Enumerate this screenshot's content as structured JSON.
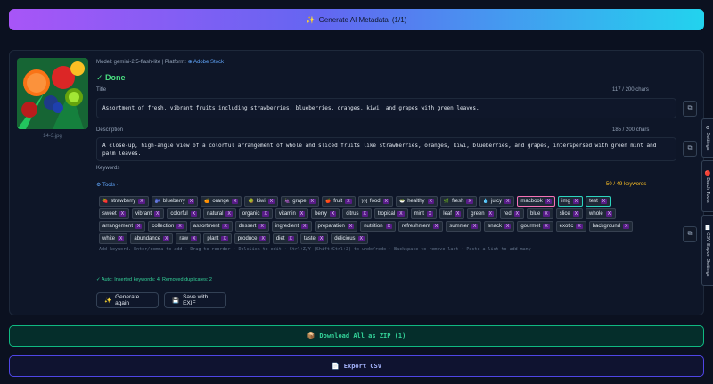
{
  "generate_button": {
    "icon": "✨",
    "label": "Generate AI Metadata",
    "count": "(1/1)"
  },
  "image": {
    "filename": "14-3.jpg"
  },
  "meta": {
    "model_label": "Model: gemini-2.5-flash-lite | Platform:",
    "platform_icon": "⊕",
    "platform": "Adobe Stock"
  },
  "status": "✓ Done",
  "title": {
    "label": "Title",
    "count": "117 / 200 chars",
    "value": "Assortment of fresh, vibrant fruits including strawberries, blueberries, oranges, kiwi, and grapes with green leaves."
  },
  "description": {
    "label": "Description",
    "count": "185 / 200 chars",
    "value": "A close-up, high-angle view of a colorful arrangement of whole and sliced fruits like strawberries, oranges, kiwi, blueberries, and grapes, interspersed with green mint and palm leaves."
  },
  "keywords": {
    "label": "Keywords",
    "tools_label": "⚙ Tools ·",
    "count": "50 / 49 keywords",
    "remove_glyph": "X",
    "items": [
      {
        "emoji": "🍓",
        "text": "strawberry",
        "style": "normal"
      },
      {
        "emoji": "🫐",
        "text": "blueberry",
        "style": "normal"
      },
      {
        "emoji": "🍊",
        "text": "orange",
        "style": "normal"
      },
      {
        "emoji": "🥝",
        "text": "kiwi",
        "style": "normal"
      },
      {
        "emoji": "🍇",
        "text": "grape",
        "style": "normal"
      },
      {
        "emoji": "🍎",
        "text": "fruit",
        "style": "normal"
      },
      {
        "emoji": "🍽",
        "text": "food",
        "style": "normal"
      },
      {
        "emoji": "🥗",
        "text": "healthy",
        "style": "normal"
      },
      {
        "emoji": "🌿",
        "text": "fresh",
        "style": "normal"
      },
      {
        "emoji": "💧",
        "text": "juicy",
        "style": "normal"
      },
      {
        "emoji": "",
        "text": "macbook",
        "style": "pink"
      },
      {
        "emoji": "",
        "text": "img",
        "style": "teal"
      },
      {
        "emoji": "",
        "text": "test",
        "style": "teal"
      },
      {
        "emoji": "",
        "text": "sweet",
        "style": "normal"
      },
      {
        "emoji": "",
        "text": "vibrant",
        "style": "normal"
      },
      {
        "emoji": "",
        "text": "colorful",
        "style": "normal"
      },
      {
        "emoji": "",
        "text": "natural",
        "style": "normal"
      },
      {
        "emoji": "",
        "text": "organic",
        "style": "normal"
      },
      {
        "emoji": "",
        "text": "vitamin",
        "style": "normal"
      },
      {
        "emoji": "",
        "text": "berry",
        "style": "normal"
      },
      {
        "emoji": "",
        "text": "citrus",
        "style": "normal"
      },
      {
        "emoji": "",
        "text": "tropical",
        "style": "normal"
      },
      {
        "emoji": "",
        "text": "mint",
        "style": "normal"
      },
      {
        "emoji": "",
        "text": "leaf",
        "style": "normal"
      },
      {
        "emoji": "",
        "text": "green",
        "style": "normal"
      },
      {
        "emoji": "",
        "text": "red",
        "style": "normal"
      },
      {
        "emoji": "",
        "text": "blue",
        "style": "normal"
      },
      {
        "emoji": "",
        "text": "slice",
        "style": "normal"
      },
      {
        "emoji": "",
        "text": "whole",
        "style": "normal"
      },
      {
        "emoji": "",
        "text": "arrangement",
        "style": "normal"
      },
      {
        "emoji": "",
        "text": "collection",
        "style": "normal"
      },
      {
        "emoji": "",
        "text": "assortment",
        "style": "normal"
      },
      {
        "emoji": "",
        "text": "dessert",
        "style": "normal"
      },
      {
        "emoji": "",
        "text": "ingredient",
        "style": "normal"
      },
      {
        "emoji": "",
        "text": "preparation",
        "style": "normal"
      },
      {
        "emoji": "",
        "text": "nutrition",
        "style": "normal"
      },
      {
        "emoji": "",
        "text": "refreshment",
        "style": "normal"
      },
      {
        "emoji": "",
        "text": "summer",
        "style": "normal"
      },
      {
        "emoji": "",
        "text": "snack",
        "style": "normal"
      },
      {
        "emoji": "",
        "text": "gourmet",
        "style": "normal"
      },
      {
        "emoji": "",
        "text": "exotic",
        "style": "normal"
      },
      {
        "emoji": "",
        "text": "background",
        "style": "normal"
      },
      {
        "emoji": "",
        "text": "white",
        "style": "normal"
      },
      {
        "emoji": "",
        "text": "abundance",
        "style": "normal"
      },
      {
        "emoji": "",
        "text": "raw",
        "style": "normal"
      },
      {
        "emoji": "",
        "text": "plant",
        "style": "normal"
      },
      {
        "emoji": "",
        "text": "produce",
        "style": "normal"
      },
      {
        "emoji": "",
        "text": "diet",
        "style": "normal"
      },
      {
        "emoji": "",
        "text": "taste",
        "style": "normal"
      },
      {
        "emoji": "",
        "text": "delicious",
        "style": "normal"
      }
    ],
    "hint": "Add keyword. Enter/comma to add · Drag to reorder · Dblclick to edit · Ctrl+Z/Y (Shift+Ctrl+Z) to undo/redo · Backspace to remove last · Paste a list to add many"
  },
  "auto_note": "✓ Auto: Inserted keywords: 4; Removed duplicates: 2",
  "actions": {
    "regenerate": {
      "icon": "✨",
      "label": "Generate again"
    },
    "save_exif": {
      "icon": "💾",
      "label": "Save with EXIF"
    }
  },
  "copy_icon": "⧉",
  "download_zip": {
    "icon": "📦",
    "label": "Download All as ZIP (1)"
  },
  "export_csv": {
    "icon": "📄",
    "label": "Export CSV"
  },
  "side_tabs": [
    {
      "icon": "⚙",
      "label": "Settings"
    },
    {
      "icon": "🔴",
      "label": "Batch Tools"
    },
    {
      "icon": "📄",
      "label": "CSV Export Settings"
    }
  ],
  "colors": {
    "accent_gradient_start": "#a855f7",
    "accent_gradient_end": "#22d3ee",
    "success": "#34d399",
    "chip_remove": "#581c87"
  }
}
